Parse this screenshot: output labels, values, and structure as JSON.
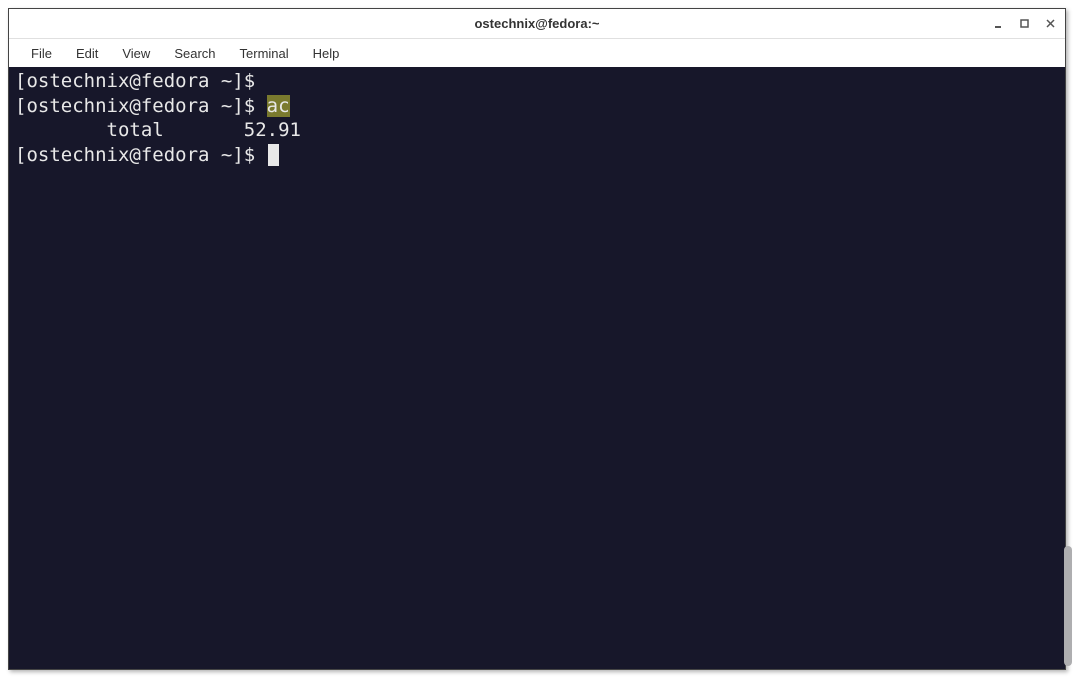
{
  "window": {
    "title": "ostechnix@fedora:~"
  },
  "menubar": {
    "items": [
      "File",
      "Edit",
      "View",
      "Search",
      "Terminal",
      "Help"
    ]
  },
  "terminal": {
    "lines": [
      {
        "prompt": "[ostechnix@fedora ~]$",
        "command": "",
        "highlight": false
      },
      {
        "prompt": "[ostechnix@fedora ~]$ ",
        "command": "ac",
        "highlight": true
      },
      {
        "output": "        total       52.91"
      },
      {
        "prompt": "[ostechnix@fedora ~]$ ",
        "cursor": true
      }
    ]
  },
  "controls": {
    "minimize": "-",
    "maximize": "◦",
    "close": "×"
  }
}
